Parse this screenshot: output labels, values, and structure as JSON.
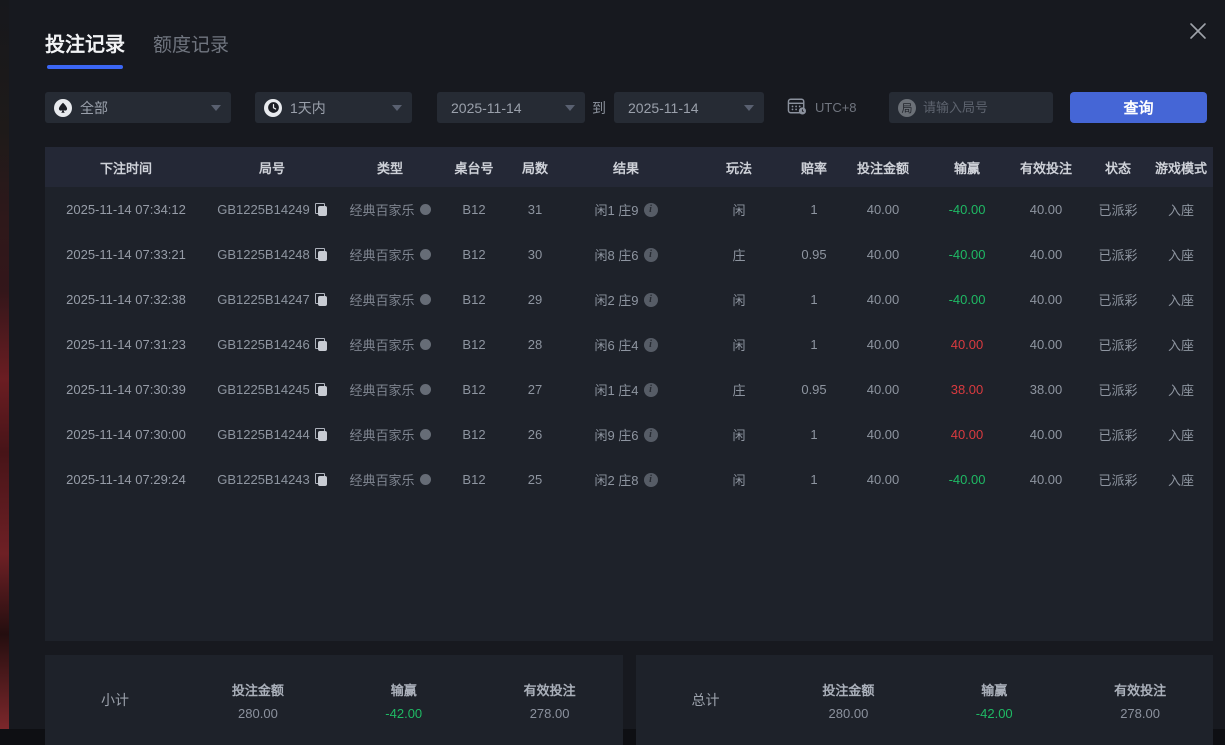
{
  "tabs": [
    {
      "label": "投注记录",
      "active": true
    },
    {
      "label": "额度记录",
      "active": false
    }
  ],
  "filters": {
    "game_type": "全部",
    "time_range": "1天内",
    "date_from": "2025-11-14",
    "to_label": "到",
    "date_to": "2025-11-14",
    "timezone": "UTC+8",
    "round_badge_char": "局",
    "round_placeholder": "请输入局号",
    "query_label": "查询"
  },
  "table": {
    "columns": [
      "下注时间",
      "局号",
      "类型",
      "桌台号",
      "局数",
      "结果",
      "玩法",
      "赔率",
      "投注金额",
      "输赢",
      "有效投注",
      "状态",
      "游戏模式"
    ],
    "rows": [
      {
        "time": "2025-11-14 07:34:12",
        "round_id": "GB1225B14249",
        "type": "经典百家乐",
        "table_no": "B12",
        "round_no": "31",
        "result": "闲1 庄9",
        "play": "闲",
        "odds": "1",
        "bet": "40.00",
        "winloss": "-40.00",
        "winloss_color": "green",
        "valid": "40.00",
        "status": "已派彩",
        "mode": "入座"
      },
      {
        "time": "2025-11-14 07:33:21",
        "round_id": "GB1225B14248",
        "type": "经典百家乐",
        "table_no": "B12",
        "round_no": "30",
        "result": "闲8 庄6",
        "play": "庄",
        "odds": "0.95",
        "bet": "40.00",
        "winloss": "-40.00",
        "winloss_color": "green",
        "valid": "40.00",
        "status": "已派彩",
        "mode": "入座"
      },
      {
        "time": "2025-11-14 07:32:38",
        "round_id": "GB1225B14247",
        "type": "经典百家乐",
        "table_no": "B12",
        "round_no": "29",
        "result": "闲2 庄9",
        "play": "闲",
        "odds": "1",
        "bet": "40.00",
        "winloss": "-40.00",
        "winloss_color": "green",
        "valid": "40.00",
        "status": "已派彩",
        "mode": "入座"
      },
      {
        "time": "2025-11-14 07:31:23",
        "round_id": "GB1225B14246",
        "type": "经典百家乐",
        "table_no": "B12",
        "round_no": "28",
        "result": "闲6 庄4",
        "play": "闲",
        "odds": "1",
        "bet": "40.00",
        "winloss": "40.00",
        "winloss_color": "red",
        "valid": "40.00",
        "status": "已派彩",
        "mode": "入座"
      },
      {
        "time": "2025-11-14 07:30:39",
        "round_id": "GB1225B14245",
        "type": "经典百家乐",
        "table_no": "B12",
        "round_no": "27",
        "result": "闲1 庄4",
        "play": "庄",
        "odds": "0.95",
        "bet": "40.00",
        "winloss": "38.00",
        "winloss_color": "red",
        "valid": "38.00",
        "status": "已派彩",
        "mode": "入座"
      },
      {
        "time": "2025-11-14 07:30:00",
        "round_id": "GB1225B14244",
        "type": "经典百家乐",
        "table_no": "B12",
        "round_no": "26",
        "result": "闲9 庄6",
        "play": "闲",
        "odds": "1",
        "bet": "40.00",
        "winloss": "40.00",
        "winloss_color": "red",
        "valid": "40.00",
        "status": "已派彩",
        "mode": "入座"
      },
      {
        "time": "2025-11-14 07:29:24",
        "round_id": "GB1225B14243",
        "type": "经典百家乐",
        "table_no": "B12",
        "round_no": "25",
        "result": "闲2 庄8",
        "play": "闲",
        "odds": "1",
        "bet": "40.00",
        "winloss": "-40.00",
        "winloss_color": "green",
        "valid": "40.00",
        "status": "已派彩",
        "mode": "入座"
      }
    ]
  },
  "summary": {
    "subtotal": {
      "label": "小计",
      "bet_label": "投注金额",
      "bet": "280.00",
      "winloss_label": "输赢",
      "winloss": "-42.00",
      "winloss_color": "green",
      "valid_label": "有效投注",
      "valid": "278.00"
    },
    "total": {
      "label": "总计",
      "bet_label": "投注金额",
      "bet": "280.00",
      "winloss_label": "输赢",
      "winloss": "-42.00",
      "winloss_color": "green",
      "valid_label": "有效投注",
      "valid": "278.00"
    }
  },
  "colors": {
    "green": "#1fb964",
    "red": "#d93a3f",
    "accent_blue": "#4566d6"
  }
}
